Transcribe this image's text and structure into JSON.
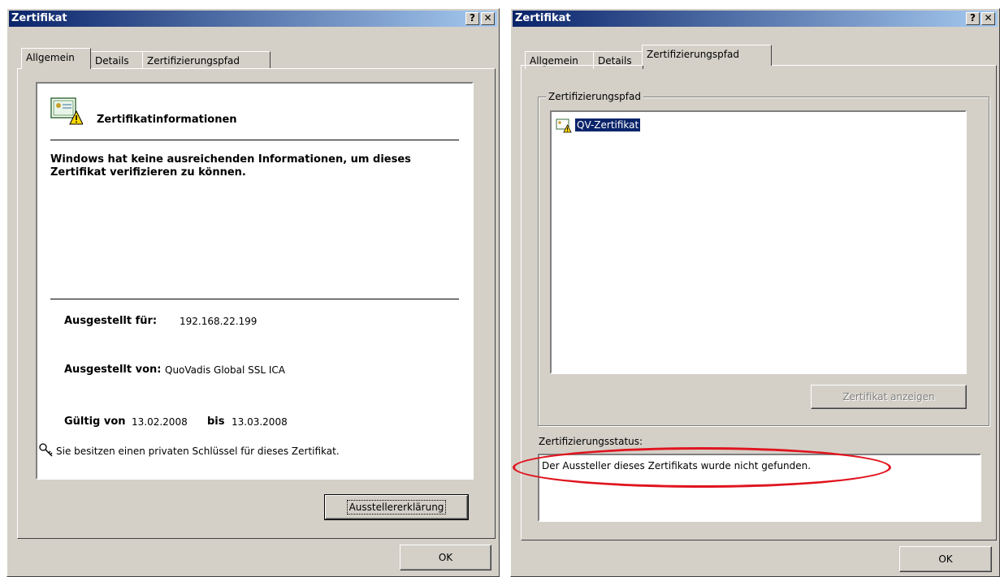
{
  "left_window": {
    "title": "Zertifikat",
    "help_btn": "?",
    "close_btn": "✕",
    "tabs": [
      "Allgemein",
      "Details",
      "Zertifizierungspfad"
    ],
    "cert_heading": "Zertifikatinformationen",
    "warning_message": "Windows hat keine ausreichenden Informationen, um dieses Zertifikat verifizieren zu können.",
    "issued_to_label": "Ausgestellt für:",
    "issued_to_value": "192.168.22.199",
    "issued_by_label": "Ausgestellt von:",
    "issued_by_value": "QuoVadis Global SSL ICA",
    "valid_from_label": "Gültig von",
    "valid_from_value": "13.02.2008",
    "valid_to_label": "bis",
    "valid_to_value": "13.03.2008",
    "private_key_note": "Sie besitzen einen privaten Schlüssel für dieses Zertifikat.",
    "issuer_statement_btn": "Ausstellererklärung",
    "ok_btn": "OK"
  },
  "right_window": {
    "title": "Zertifikat",
    "help_btn": "?",
    "close_btn": "✕",
    "tabs": [
      "Allgemein",
      "Details",
      "Zertifizierungspfad"
    ],
    "path_group_label": "Zertifizierungspfad",
    "path_items": [
      "QV-Zertifikat"
    ],
    "view_cert_btn": "Zertifikat anzeigen",
    "status_label": "Zertifizierungsstatus:",
    "status_text": "Der Aussteller dieses Zertifikats wurde nicht gefunden.",
    "ok_btn": "OK"
  },
  "colors": {
    "titlebar_start": "#0a246a",
    "titlebar_end": "#a6caf0",
    "dialog_face": "#d4d0c8",
    "highlight_ellipse": "#e0141e"
  }
}
